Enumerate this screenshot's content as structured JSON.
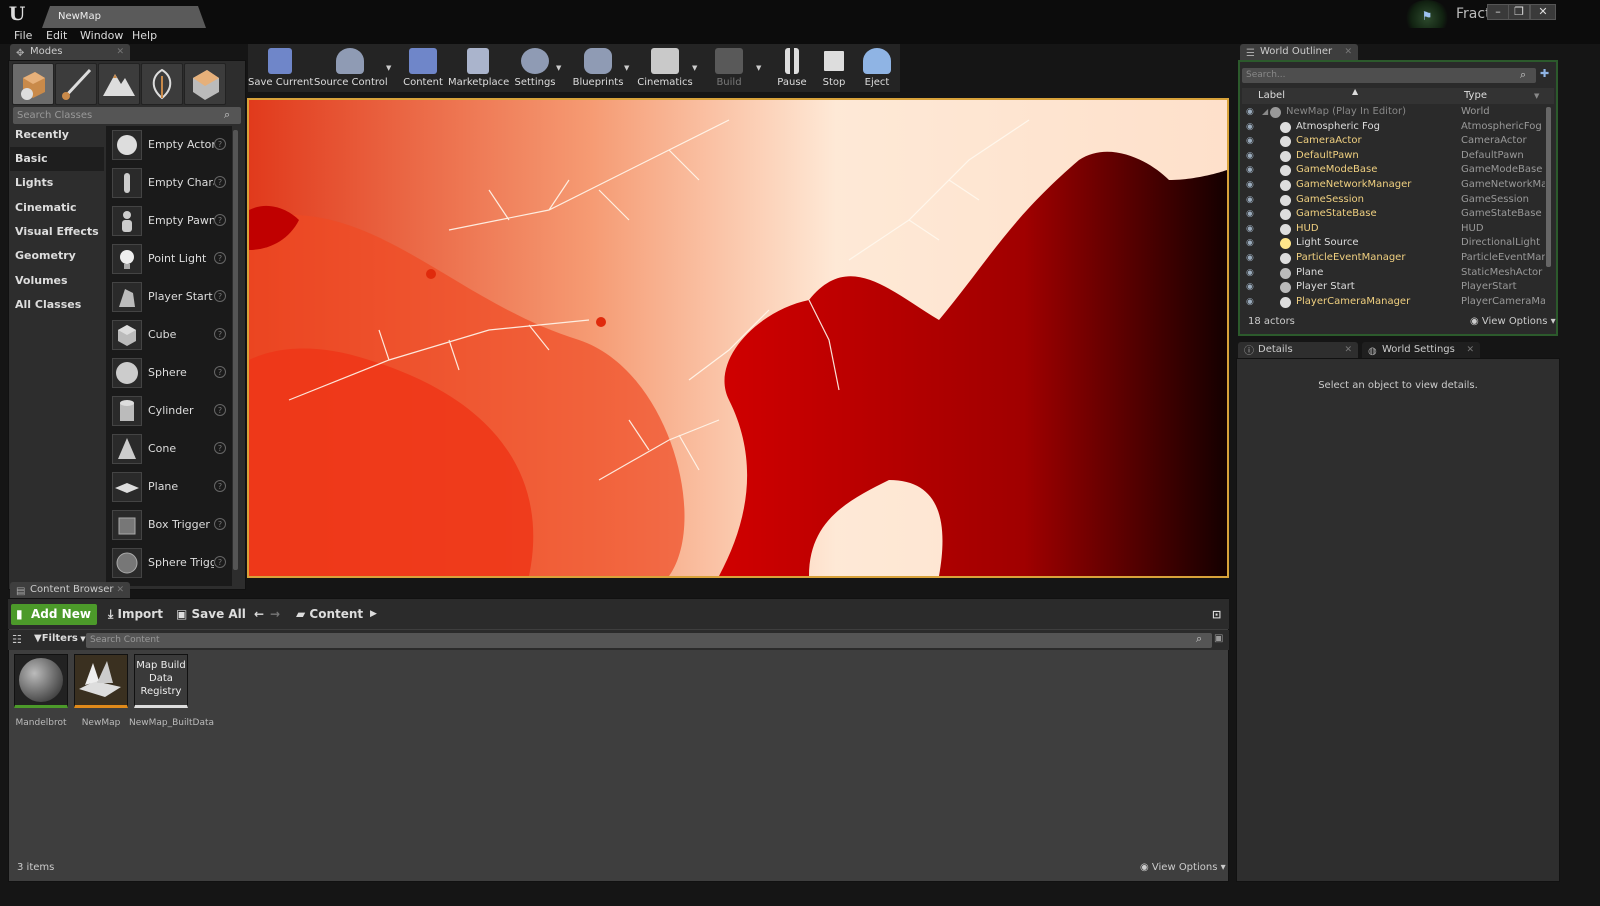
{
  "window": {
    "tab_title": "NewMap",
    "project_name": "Fractal",
    "minimize": "–",
    "maximize": "❐",
    "close": "✕"
  },
  "menu": {
    "items": [
      "File",
      "Edit",
      "Window",
      "Help"
    ]
  },
  "modes": {
    "tab_label": "Modes",
    "search_placeholder": "Search Classes",
    "categories": [
      "Recently Placed",
      "Basic",
      "Lights",
      "Cinematic",
      "Visual Effects",
      "Geometry",
      "Volumes",
      "All Classes"
    ],
    "selected_category": "Basic",
    "items": [
      "Empty Actor",
      "Empty Charac",
      "Empty Pawn",
      "Point Light",
      "Player Start",
      "Cube",
      "Sphere",
      "Cylinder",
      "Cone",
      "Plane",
      "Box Trigger",
      "Sphere Trigge"
    ]
  },
  "toolbar": {
    "buttons": [
      "Save Current",
      "Source Control",
      "Content",
      "Marketplace",
      "Settings",
      "Blueprints",
      "Cinematics",
      "Build",
      "Pause",
      "Stop",
      "Eject"
    ]
  },
  "outliner": {
    "tab_label": "World Outliner",
    "search_placeholder": "Search...",
    "col_label": "Label",
    "col_type": "Type",
    "rows": [
      {
        "label": "NewMap (Play In Editor)",
        "type": "World"
      },
      {
        "label": "Atmospheric Fog",
        "type": "AtmosphericFog"
      },
      {
        "label": "CameraActor",
        "type": "CameraActor"
      },
      {
        "label": "DefaultPawn",
        "type": "DefaultPawn"
      },
      {
        "label": "GameModeBase",
        "type": "GameModeBase"
      },
      {
        "label": "GameNetworkManager",
        "type": "GameNetworkMana"
      },
      {
        "label": "GameSession",
        "type": "GameSession"
      },
      {
        "label": "GameStateBase",
        "type": "GameStateBase"
      },
      {
        "label": "HUD",
        "type": "HUD"
      },
      {
        "label": "Light Source",
        "type": "DirectionalLight"
      },
      {
        "label": "ParticleEventManager",
        "type": "ParticleEventMana"
      },
      {
        "label": "Plane",
        "type": "StaticMeshActor"
      },
      {
        "label": "Player Start",
        "type": "PlayerStart"
      },
      {
        "label": "PlayerCameraManager",
        "type": "PlayerCameraMan"
      }
    ],
    "actor_count": "18 actors",
    "view_options": "View Options"
  },
  "details": {
    "tab_label": "Details",
    "world_settings_label": "World Settings",
    "empty_message": "Select an object to view details."
  },
  "content_browser": {
    "tab_label": "Content Browser",
    "add_new": "Add New",
    "import": "Import",
    "save_all": "Save All",
    "path": "Content",
    "filters": "Filters",
    "search_placeholder": "Search Content",
    "assets": [
      {
        "name": "Mandelbrot"
      },
      {
        "name": "NewMap"
      },
      {
        "name": "NewMap_BuiltData",
        "thumb_text": "Map Build Data Registry"
      }
    ],
    "items_count": "3 items",
    "view_options": "View Options"
  },
  "colors": {
    "accent_green": "#4c9a2a",
    "viewport_border": "#d8a23a",
    "outliner_link": "#f0d080"
  }
}
